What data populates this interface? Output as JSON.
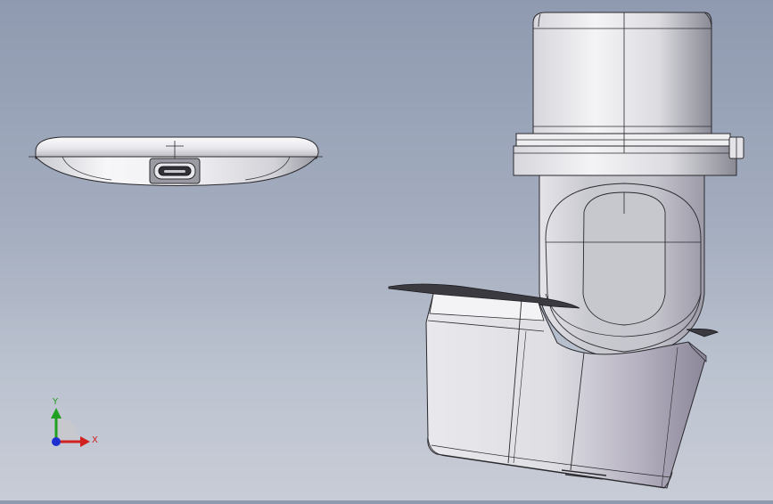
{
  "viewport": {
    "background_top": "#8f9ab0",
    "background_bottom": "#c8ccd6"
  },
  "triad": {
    "x_label": "X",
    "y_label": "Y",
    "x_color": "#d02020",
    "y_color": "#20a020",
    "z_color": "#2030d0"
  },
  "models": {
    "left_part": "usb-c-device-side-view",
    "right_part": "elbow-assembly-view"
  },
  "colors": {
    "part_light": "#f4f4f6",
    "part_mid": "#cfd0d6",
    "part_dark": "#8e8e98",
    "edge": "#2a2a2e"
  }
}
